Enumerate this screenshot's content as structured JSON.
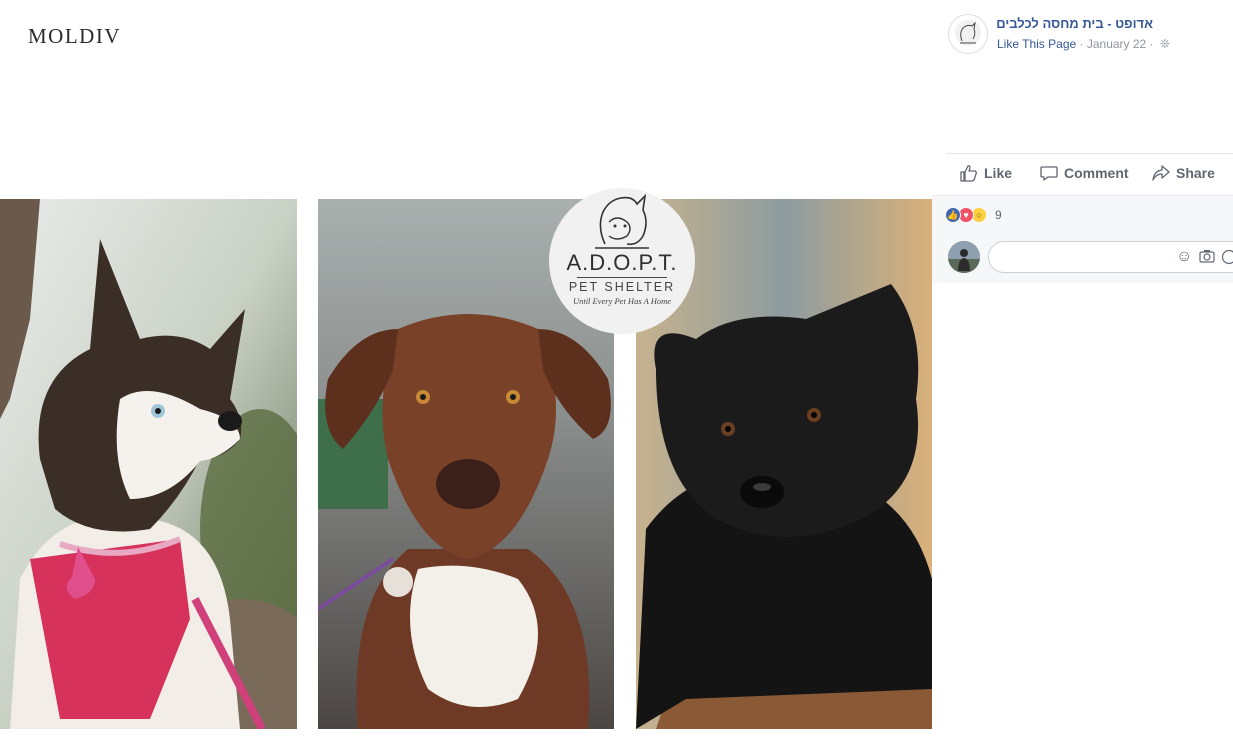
{
  "photo": {
    "watermark": "MOLDIV",
    "logo": {
      "title": "A.D.O.P.T.",
      "subtitle": "PET SHELTER",
      "tagline": "Until Every Pet Has A Home",
      "icon": "dog-cat-outline-icon"
    }
  },
  "post": {
    "page_name": "אדופט - בית מחסה לכלבים",
    "like_link": "Like This Page",
    "separator": " · ",
    "date": "January 22",
    "privacy_icon": "globe-icon"
  },
  "actions": {
    "like": "Like",
    "comment": "Comment",
    "share": "Share"
  },
  "reactions": {
    "icons": [
      "like-icon",
      "love-icon",
      "wow-icon"
    ],
    "count": "9"
  },
  "comment_box": {
    "placeholder": "",
    "icons": [
      "emoji-icon",
      "camera-icon",
      "gif-icon"
    ]
  },
  "colors": {
    "link": "#365899",
    "meta": "#90949c",
    "action_text": "#606770",
    "panel_bg": "#f6f7f9"
  }
}
